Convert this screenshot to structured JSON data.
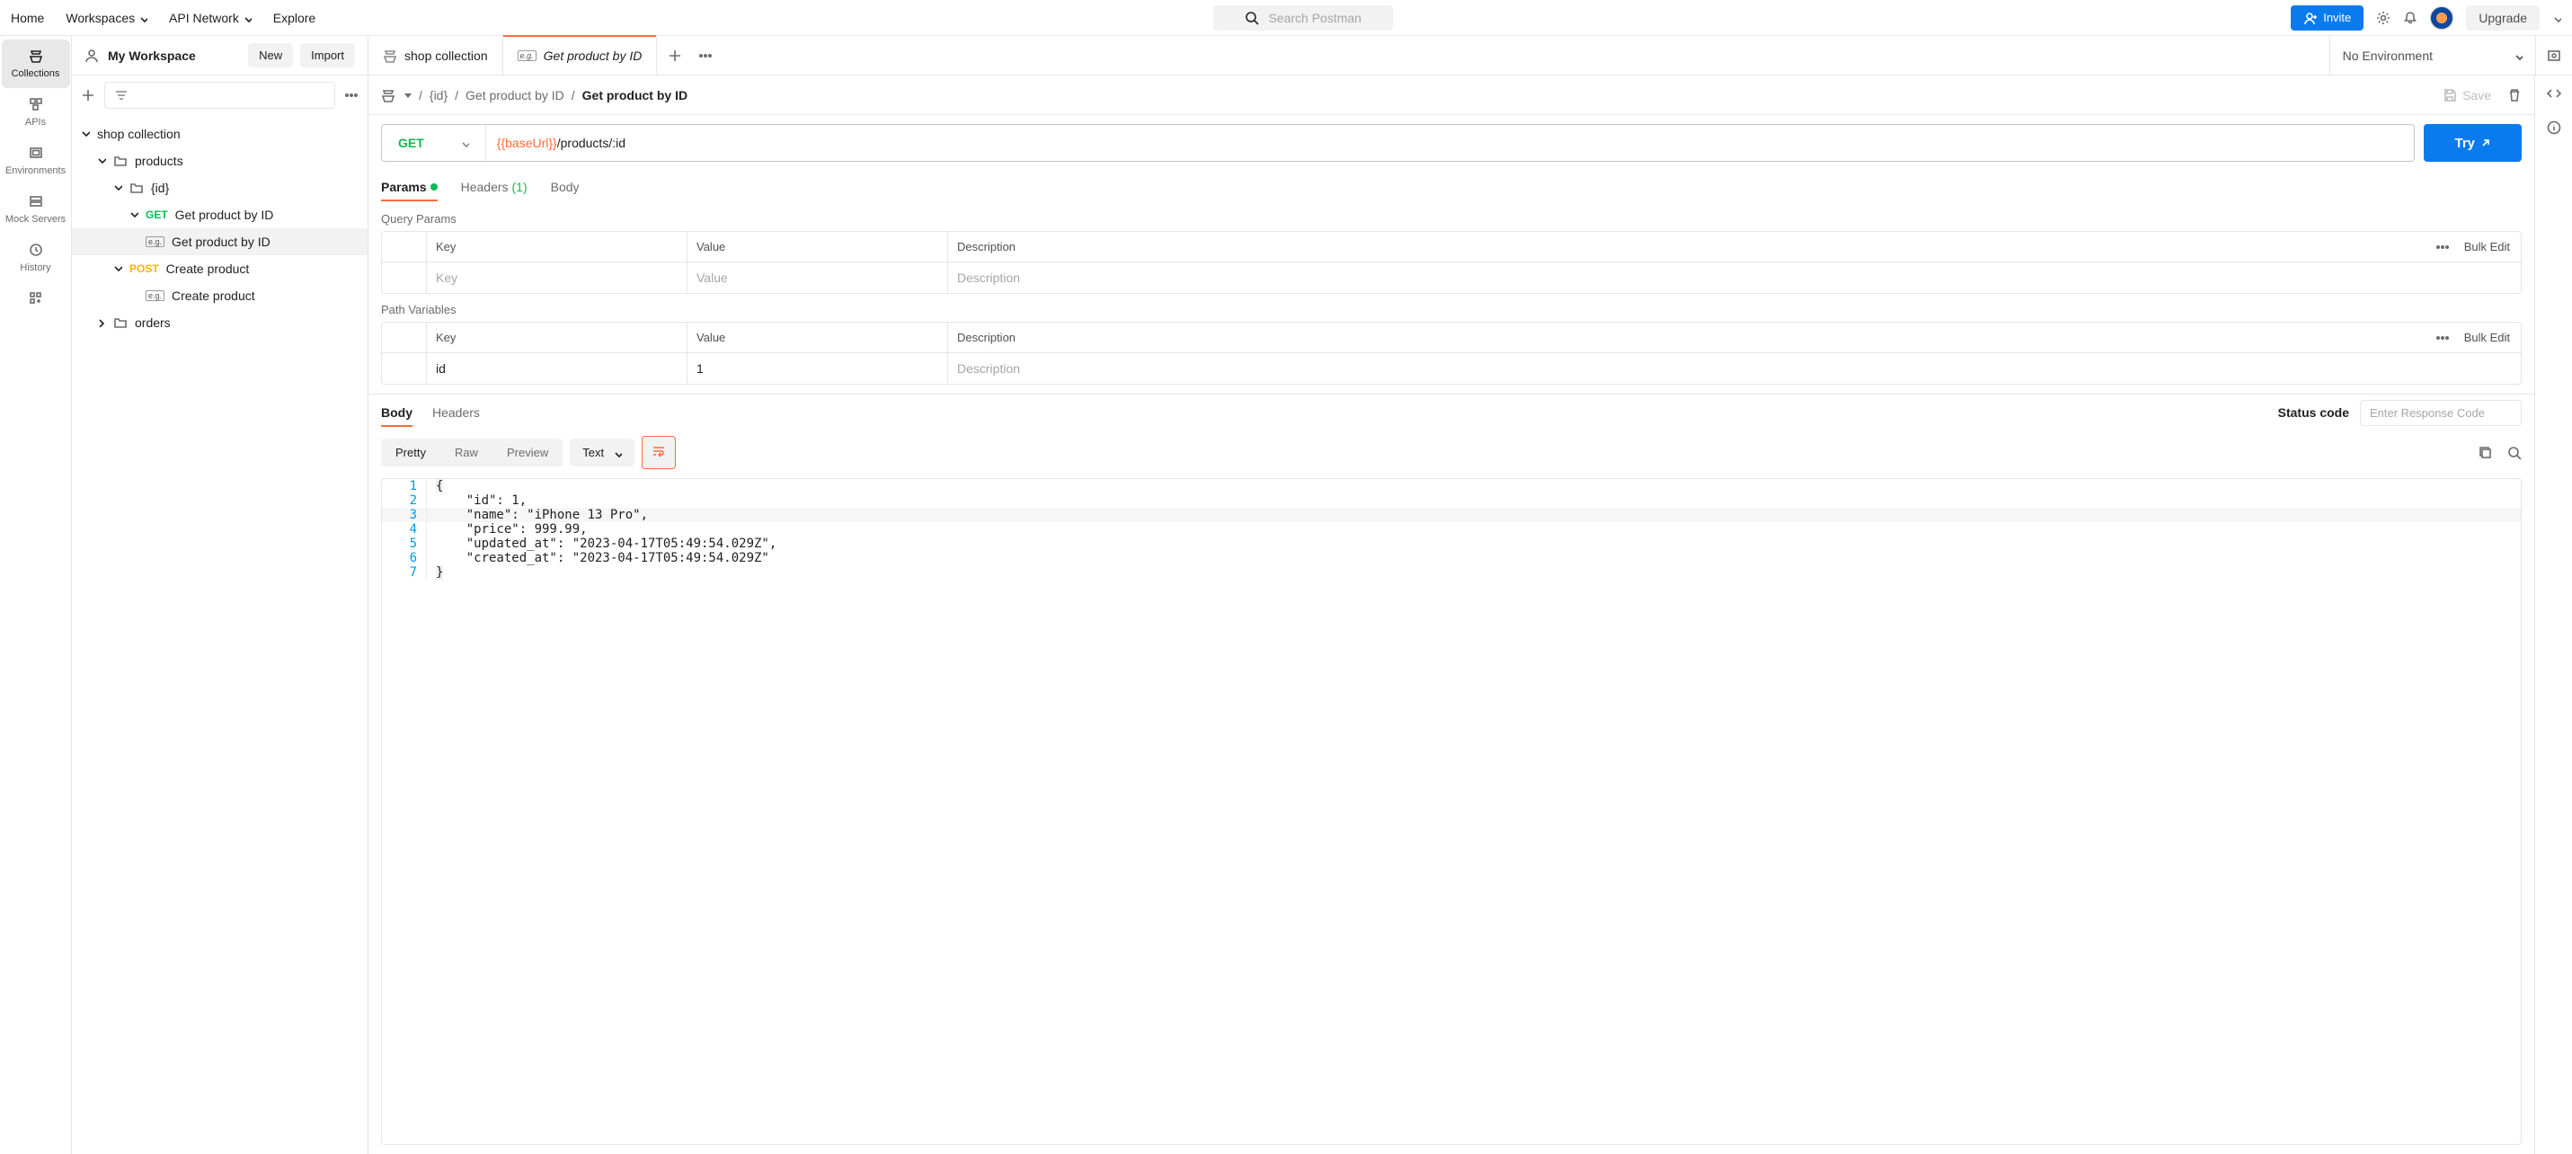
{
  "topbar": {
    "home": "Home",
    "workspaces": "Workspaces",
    "api_network": "API Network",
    "explore": "Explore",
    "search_placeholder": "Search Postman",
    "invite": "Invite",
    "upgrade": "Upgrade"
  },
  "workspace": {
    "title": "My Workspace",
    "new_btn": "New",
    "import_btn": "Import"
  },
  "left_rail": {
    "collections": "Collections",
    "apis": "APIs",
    "environments": "Environments",
    "mock_servers": "Mock Servers",
    "history": "History"
  },
  "tree": {
    "root": "shop collection",
    "products": "products",
    "id_folder": "{id}",
    "get_req": {
      "method": "GET",
      "name": "Get product by ID"
    },
    "get_example": "Get product by ID",
    "post_req": {
      "method": "POST",
      "name": "Create product"
    },
    "post_example": "Create product",
    "orders": "orders"
  },
  "tabs": {
    "tab1": "shop collection",
    "tab2": "Get product by ID"
  },
  "env": {
    "selected": "No Environment"
  },
  "breadcrumb": {
    "p1": "{id}",
    "p2": "Get product by ID",
    "p3": "Get product by ID",
    "save": "Save"
  },
  "request": {
    "method": "GET",
    "url_var": "{{baseUrl}}",
    "url_rest": "/products/:id",
    "try": "Try"
  },
  "req_tabs": {
    "params": "Params",
    "headers": "Headers",
    "headers_count": "(1)",
    "body": "Body"
  },
  "query_params": {
    "title": "Query Params",
    "key_header": "Key",
    "value_header": "Value",
    "desc_header": "Description",
    "bulk_edit": "Bulk Edit",
    "key_ph": "Key",
    "value_ph": "Value",
    "desc_ph": "Description"
  },
  "path_vars": {
    "title": "Path Variables",
    "key_header": "Key",
    "value_header": "Value",
    "desc_header": "Description",
    "bulk_edit": "Bulk Edit",
    "rows": [
      {
        "key": "id",
        "value": "1",
        "desc": ""
      }
    ],
    "desc_ph": "Description"
  },
  "response": {
    "body_tab": "Body",
    "headers_tab": "Headers",
    "status_label": "Status code",
    "status_ph": "Enter Response Code",
    "pretty": "Pretty",
    "raw": "Raw",
    "preview": "Preview",
    "fmt": "Text",
    "code": {
      "l1": "{",
      "l2": "    \"id\": 1,",
      "l3": "    \"name\": \"iPhone 13 Pro\",",
      "l4": "    \"price\": 999.99,",
      "l5": "    \"updated_at\": \"2023-04-17T05:49:54.029Z\",",
      "l6": "    \"created_at\": \"2023-04-17T05:49:54.029Z\"",
      "l7": "}"
    }
  }
}
